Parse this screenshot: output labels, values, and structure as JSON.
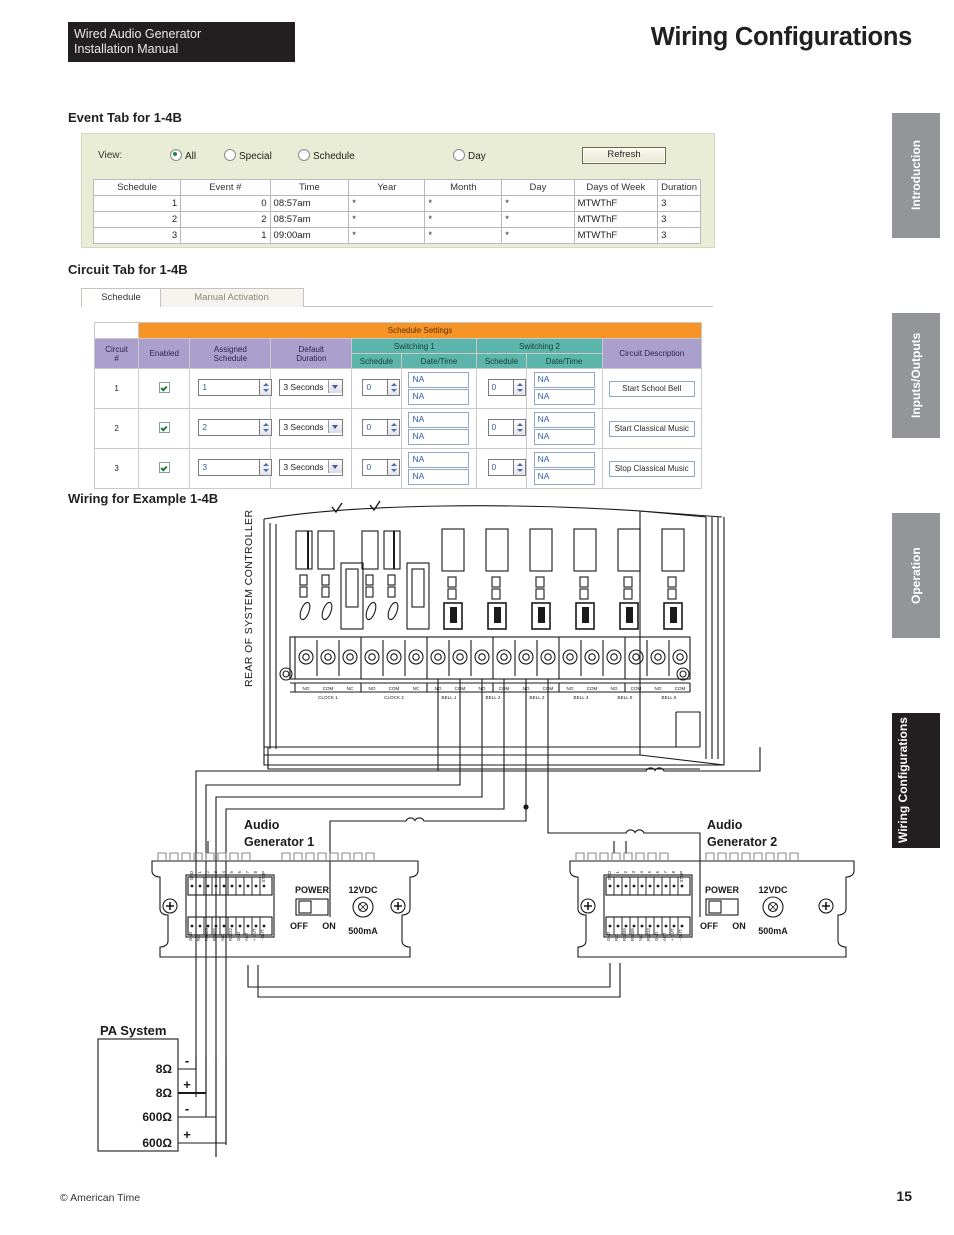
{
  "header": {
    "manual_line1": "Wired Audio Generator",
    "manual_line2": "Installation Manual",
    "title": "Wiring Configurations"
  },
  "sections": {
    "event_heading": "Event Tab for 1-4B",
    "circuit_heading": "Circuit Tab for 1-4B",
    "wiring_heading": "Wiring for Example 1-4B"
  },
  "event_tab": {
    "view_label": "View:",
    "radios": [
      {
        "label": "All",
        "selected": true
      },
      {
        "label": "Special",
        "selected": false
      },
      {
        "label": "Schedule",
        "selected": false
      },
      {
        "label": "Day",
        "selected": false
      }
    ],
    "refresh_label": "Refresh",
    "columns": [
      "Schedule",
      "Event #",
      "Time",
      "Year",
      "Month",
      "Day",
      "Days of Week",
      "Duration"
    ],
    "rows": [
      {
        "schedule": "1",
        "event": "0",
        "time": "08:57am",
        "year": "*",
        "month": "*",
        "day": "*",
        "dow": "MTWThF",
        "duration": "3"
      },
      {
        "schedule": "2",
        "event": "2",
        "time": "08:57am",
        "year": "*",
        "month": "*",
        "day": "*",
        "dow": "MTWThF",
        "duration": "3"
      },
      {
        "schedule": "3",
        "event": "1",
        "time": "09:00am",
        "year": "*",
        "month": "*",
        "day": "*",
        "dow": "MTWThF",
        "duration": "3"
      }
    ]
  },
  "circuit_tab": {
    "tabs": [
      {
        "label": "Schedule",
        "selected": true
      },
      {
        "label": "Manual Activation",
        "selected": false
      }
    ],
    "band_title": "Schedule Settings",
    "group_headers": {
      "switching1": "Switching 1",
      "switching2": "Switching 2"
    },
    "columns": {
      "circuit": "Circuit\n#",
      "circuit_l1": "Circuit",
      "circuit_l2": "#",
      "enabled": "Enabled",
      "assigned_l1": "Assigned",
      "assigned_l2": "Schedule",
      "default_l1": "Default",
      "default_l2": "Duration",
      "schedule": "Schedule",
      "datetime": "Date/Time",
      "description": "Circuit Description"
    },
    "rows": [
      {
        "circuit": "1",
        "enabled": true,
        "assigned_schedule": "1",
        "default_duration": "3 Seconds",
        "sw1_schedule": "0",
        "sw1_dt1": "NA",
        "sw1_dt2": "NA",
        "sw2_schedule": "0",
        "sw2_dt1": "NA",
        "sw2_dt2": "NA",
        "description": "Start School Bell"
      },
      {
        "circuit": "2",
        "enabled": true,
        "assigned_schedule": "2",
        "default_duration": "3 Seconds",
        "sw1_schedule": "0",
        "sw1_dt1": "NA",
        "sw1_dt2": "NA",
        "sw2_schedule": "0",
        "sw2_dt1": "NA",
        "sw2_dt2": "NA",
        "description": "Start Classical Music"
      },
      {
        "circuit": "3",
        "enabled": true,
        "assigned_schedule": "3",
        "default_duration": "3 Seconds",
        "sw1_schedule": "0",
        "sw1_dt1": "NA",
        "sw1_dt2": "NA",
        "sw2_schedule": "0",
        "sw2_dt1": "NA",
        "sw2_dt2": "NA",
        "description": "Stop Classical Music"
      }
    ]
  },
  "diagram": {
    "controller_label": "REAR OF SYSTEM CONTROLLER",
    "terminal_groups": [
      {
        "name": "CLOCK 1",
        "pins": [
          "NO",
          "COM",
          "NC"
        ]
      },
      {
        "name": "CLOCK 2",
        "pins": [
          "NO",
          "COM",
          "NC"
        ]
      },
      {
        "name": "BELL 1",
        "pins": [
          "NO",
          "COM"
        ]
      },
      {
        "name": "BELL 2",
        "pins": [
          "NO",
          "COM"
        ]
      },
      {
        "name": "BELL 3",
        "pins": [
          "NO",
          "COM"
        ]
      },
      {
        "name": "BELL 4",
        "pins": [
          "NO",
          "COM"
        ]
      },
      {
        "name": "BELL 5",
        "pins": [
          "NO",
          "COM"
        ]
      },
      {
        "name": "BELL 6",
        "pins": [
          "NO",
          "COM"
        ]
      }
    ],
    "generator1_l1": "Audio",
    "generator1_l2": "Generator 1",
    "generator2_l1": "Audio",
    "generator2_l2": "Generator 2",
    "generator_top_pins": [
      "GND",
      "1",
      "2",
      "3",
      "4",
      "5",
      "6",
      "7",
      "8",
      "STOP"
    ],
    "generator_bottom_pins": [
      "GND",
      "RO",
      "RS485",
      "RS485",
      "N/C",
      "RS232",
      "GND",
      "ACT",
      "+ OUT",
      "- OUT"
    ],
    "power_label": "POWER",
    "power_off": "OFF",
    "power_on": "ON",
    "dc_label": "12VDC",
    "dc_current": "500mA",
    "pa_title": "PA System",
    "pa_terminals": [
      {
        "label": "8Ω",
        "polarity": "-"
      },
      {
        "label": "8Ω",
        "polarity": "+"
      },
      {
        "label": "600Ω",
        "polarity": "-"
      },
      {
        "label": "600Ω",
        "polarity": "+"
      }
    ]
  },
  "side_tabs": [
    {
      "label": "Introduction",
      "active": false
    },
    {
      "label": "Inputs/Outputs",
      "active": false
    },
    {
      "label": "Operation",
      "active": false
    },
    {
      "label_l1": "Wiring",
      "label_l2": "Configurations",
      "active": true
    }
  ],
  "footer": {
    "copyright": "© American Time",
    "page_number": "15"
  }
}
